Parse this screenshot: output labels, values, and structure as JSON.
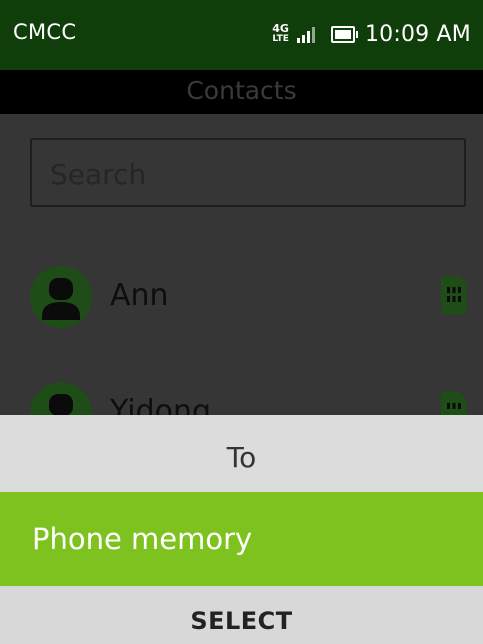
{
  "status_bar": {
    "carrier": "CMCC",
    "network_type_top": "4G",
    "network_type_bottom": "LTE",
    "signal_icon": "signal-bars-icon",
    "battery_icon": "battery-icon",
    "time": "10:09 AM"
  },
  "header": {
    "title": "Contacts"
  },
  "search": {
    "placeholder": "Search"
  },
  "contacts": [
    {
      "name": "Ann",
      "avatar_icon": "person-icon",
      "storage_icon": "sim-card-icon"
    },
    {
      "name": "Yidong",
      "avatar_icon": "person-icon",
      "storage_icon": "sim-card-icon"
    }
  ],
  "dialog": {
    "title": "To",
    "options": [
      {
        "label": "Phone memory",
        "selected": true
      }
    ]
  },
  "softkeys": {
    "center": "SELECT"
  },
  "colors": {
    "status_bar_bg": "#103e0b",
    "accent_green": "#7dc21f",
    "dimmed_avatar": "#1e4d17",
    "dialog_bg": "#dcdcdc"
  }
}
